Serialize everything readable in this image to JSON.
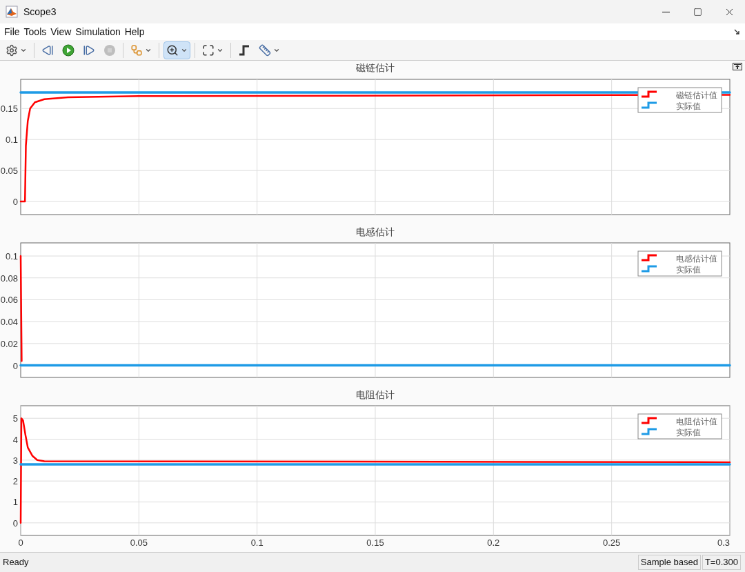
{
  "window": {
    "title": "Scope3"
  },
  "menu": [
    {
      "label": "File"
    },
    {
      "label": "Tools"
    },
    {
      "label": "View"
    },
    {
      "label": "Simulation"
    },
    {
      "label": "Help"
    }
  ],
  "toolbar": [
    {
      "kind": "settings",
      "dropdown": true,
      "selected": false,
      "disabled": false
    },
    {
      "kind": "step-back",
      "dropdown": false,
      "selected": false,
      "disabled": false
    },
    {
      "kind": "run",
      "dropdown": false,
      "selected": false,
      "disabled": false
    },
    {
      "kind": "step-forward",
      "dropdown": false,
      "selected": false,
      "disabled": false
    },
    {
      "kind": "stop",
      "dropdown": false,
      "selected": false,
      "disabled": true
    },
    {
      "kind": "diagram",
      "dropdown": true,
      "selected": false,
      "disabled": false
    },
    {
      "kind": "zoom",
      "dropdown": true,
      "selected": true,
      "disabled": false
    },
    {
      "kind": "fit",
      "dropdown": true,
      "selected": false,
      "disabled": false
    },
    {
      "kind": "trigger",
      "dropdown": false,
      "selected": false,
      "disabled": false
    },
    {
      "kind": "measure",
      "dropdown": true,
      "selected": false,
      "disabled": false
    }
  ],
  "plots": [
    {
      "chart_data": {
        "type": "line",
        "title": "磁链估计",
        "grid": true,
        "legend": "upper right",
        "x": [
          0,
          0.0018,
          0.0022,
          0.003,
          0.004,
          0.006,
          0.01,
          0.02,
          0.05,
          0.3
        ],
        "xlim": [
          0,
          0.3
        ],
        "ylim": [
          -0.021,
          0.197
        ],
        "yticks": [
          0,
          0.05,
          0.1,
          0.15
        ],
        "series": [
          {
            "name": "磁链估计值",
            "color": "#ff0000",
            "values": [
              0,
              0,
              0.09,
              0.13,
              0.15,
              0.16,
              0.165,
              0.168,
              0.17,
              0.172
            ]
          },
          {
            "name": "实际值",
            "color": "#1e9be6",
            "values": [
              0.176,
              0.176,
              0.176,
              0.176,
              0.176,
              0.176,
              0.176,
              0.176,
              0.176,
              0.176
            ]
          }
        ]
      }
    },
    {
      "chart_data": {
        "type": "line",
        "title": "电感估计",
        "grid": true,
        "legend": "upper right",
        "x": [
          0,
          0.0004,
          0.3
        ],
        "xlim": [
          0,
          0.3
        ],
        "ylim": [
          -0.011,
          0.112
        ],
        "yticks": [
          0,
          0.02,
          0.04,
          0.06,
          0.08,
          0.1
        ],
        "series": [
          {
            "name": "电感估计值",
            "color": "#ff0000",
            "values": [
              0.1,
              0.004,
              null
            ]
          },
          {
            "name": "实际值",
            "color": "#1e9be6",
            "values": [
              0,
              0,
              0
            ]
          }
        ]
      }
    },
    {
      "chart_data": {
        "type": "line",
        "title": "电阻估计",
        "grid": true,
        "legend": "upper right",
        "x": [
          0,
          0.0003,
          0.001,
          0.002,
          0.003,
          0.005,
          0.007,
          0.01,
          0.3
        ],
        "xlim": [
          0,
          0.3
        ],
        "ylim": [
          -0.6,
          5.6
        ],
        "yticks": [
          0,
          1,
          2,
          3,
          4,
          5
        ],
        "xticks": [
          0,
          0.05,
          0.1,
          0.15,
          0.2,
          0.25,
          0.3
        ],
        "series": [
          {
            "name": "电阻估计值",
            "color": "#ff0000",
            "values": [
              0,
              5,
              4.9,
              4.2,
              3.6,
              3.2,
              3.0,
              2.95,
              2.9
            ]
          },
          {
            "name": "实际值",
            "color": "#1e9be6",
            "values": [
              2.8,
              2.8,
              2.8,
              2.8,
              2.8,
              2.8,
              2.8,
              2.8,
              2.8
            ]
          }
        ]
      }
    }
  ],
  "status_bar": {
    "message": "Ready",
    "mode": "Sample based",
    "time": "T=0.300"
  }
}
